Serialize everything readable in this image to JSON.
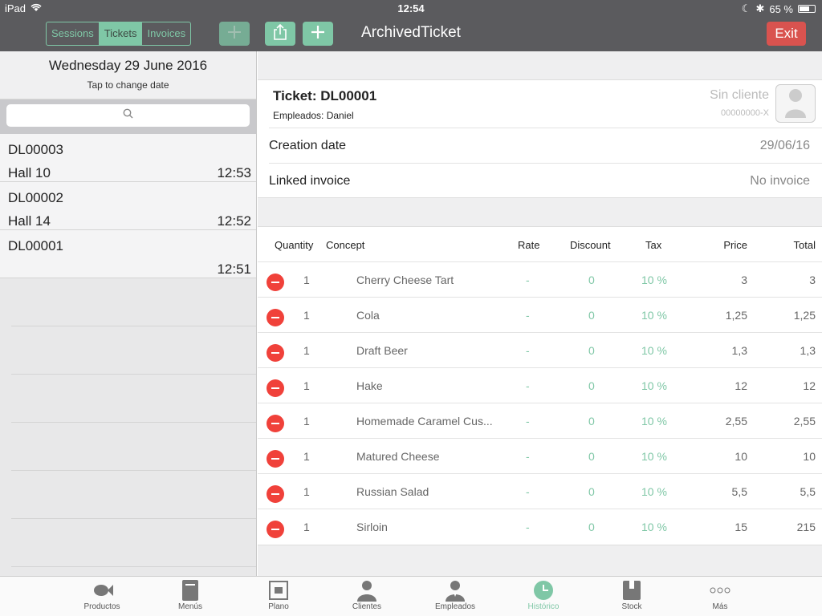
{
  "status": {
    "device": "iPad",
    "time": "12:54",
    "battery": "65 %",
    "battery_level": 0.65
  },
  "header": {
    "segments": [
      {
        "label": "Sessions",
        "active": false
      },
      {
        "label": "Tickets",
        "active": true
      },
      {
        "label": "Invoices",
        "active": false
      }
    ],
    "title": "ArchivedTicket",
    "exit_label": "Exit",
    "icons": [
      "add-icon",
      "share-icon",
      "add-icon"
    ]
  },
  "sidebar": {
    "date": "Wednesday 29 June 2016",
    "date_hint": "Tap to change date",
    "tickets": [
      {
        "code": "DL00003",
        "hall": "Hall 10",
        "time": "12:53"
      },
      {
        "code": "DL00002",
        "hall": "Hall 14",
        "time": "12:52"
      },
      {
        "code": "DL00001",
        "hall": "",
        "time": "12:51"
      }
    ]
  },
  "ticket": {
    "number": "Ticket: DL00001",
    "employees": "Empleados: Daniel",
    "client": "Sin cliente",
    "client_id": "00000000-X",
    "creation_label": "Creation date",
    "creation_value": "29/06/16",
    "invoice_label": "Linked invoice",
    "invoice_value": "No invoice"
  },
  "table": {
    "headers": {
      "quantity": "Quantity",
      "concept": "Concept",
      "rate": "Rate",
      "discount": "Discount",
      "tax": "Tax",
      "price": "Price",
      "total": "Total"
    },
    "rows": [
      {
        "qty": "1",
        "concept": "Cherry Cheese Tart",
        "rate": "-",
        "discount": "0",
        "tax": "10 %",
        "price": "3",
        "total": "3"
      },
      {
        "qty": "1",
        "concept": "Cola",
        "rate": "-",
        "discount": "0",
        "tax": "10 %",
        "price": "1,25",
        "total": "1,25"
      },
      {
        "qty": "1",
        "concept": "Draft Beer",
        "rate": "-",
        "discount": "0",
        "tax": "10 %",
        "price": "1,3",
        "total": "1,3"
      },
      {
        "qty": "1",
        "concept": "Hake",
        "rate": "-",
        "discount": "0",
        "tax": "10 %",
        "price": "12",
        "total": "12"
      },
      {
        "qty": "1",
        "concept": "Homemade Caramel Cus...",
        "rate": "-",
        "discount": "0",
        "tax": "10 %",
        "price": "2,55",
        "total": "2,55"
      },
      {
        "qty": "1",
        "concept": "Matured Cheese",
        "rate": "-",
        "discount": "0",
        "tax": "10 %",
        "price": "10",
        "total": "10"
      },
      {
        "qty": "1",
        "concept": "Russian Salad",
        "rate": "-",
        "discount": "0",
        "tax": "10 %",
        "price": "5,5",
        "total": "5,5"
      },
      {
        "qty": "1",
        "concept": "Sirloin",
        "rate": "-",
        "discount": "0",
        "tax": "10 %",
        "price": "15",
        "total": "215"
      }
    ]
  },
  "tabbar": [
    {
      "label": "Productos",
      "icon": "fish-icon",
      "active": false
    },
    {
      "label": "Menús",
      "icon": "menu-book-icon",
      "active": false
    },
    {
      "label": "Plano",
      "icon": "floor-plan-icon",
      "active": false
    },
    {
      "label": "Clientes",
      "icon": "client-icon",
      "active": false
    },
    {
      "label": "Empleados",
      "icon": "employee-icon",
      "active": false
    },
    {
      "label": "Histórico",
      "icon": "history-clock-icon",
      "active": true
    },
    {
      "label": "Stock",
      "icon": "stock-box-icon",
      "active": false
    },
    {
      "label": "Más",
      "icon": "more-dots-icon",
      "active": false
    }
  ]
}
